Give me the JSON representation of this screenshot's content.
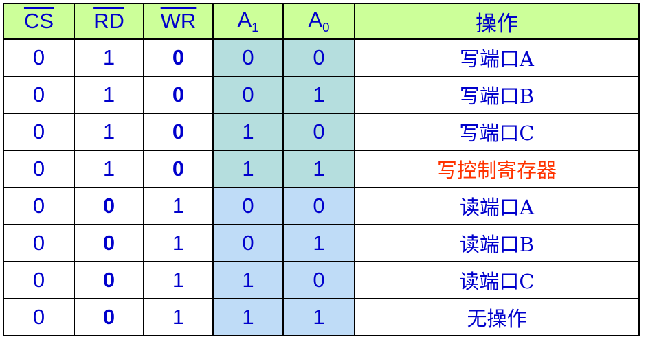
{
  "headers": {
    "cs": "CS",
    "rd": "RD",
    "wr": "WR",
    "a1_base": "A",
    "a1_sub": "1",
    "a0_base": "A",
    "a0_sub": "0",
    "op": "操作"
  },
  "colors": {
    "header_bg": "#ccff99",
    "text": "#0000cc",
    "highlight_text": "#ff3300",
    "write_address_bg": "#b5dede",
    "read_address_bg": "#bfdcf7"
  },
  "rows": [
    {
      "cs": "0",
      "rd": "1",
      "wr": "0",
      "a1": "1",
      "a0": "0",
      "op": ""
    },
    {
      "cs": "0",
      "rd": "1",
      "wr": "0",
      "a1": "0",
      "a0": "0",
      "op": "写端口A"
    },
    {
      "cs": "0",
      "rd": "1",
      "wr": "0",
      "a1": "0",
      "a0": "1",
      "op": "写端口B"
    },
    {
      "cs": "0",
      "rd": "1",
      "wr": "0",
      "a1": "1",
      "a0": "0",
      "op": "写端口C"
    },
    {
      "cs": "0",
      "rd": "1",
      "wr": "0",
      "a1": "1",
      "a0": "1",
      "op": "写控制寄存器"
    },
    {
      "cs": "0",
      "rd": "0",
      "wr": "1",
      "a1": "0",
      "a0": "0",
      "op": "读端口A"
    },
    {
      "cs": "0",
      "rd": "0",
      "wr": "1",
      "a1": "0",
      "a0": "1",
      "op": "读端口B"
    },
    {
      "cs": "0",
      "rd": "0",
      "wr": "1",
      "a1": "1",
      "a0": "0",
      "op": "读端口C"
    },
    {
      "cs": "0",
      "rd": "0",
      "wr": "1",
      "a1": "1",
      "a0": "1",
      "op": "无操作"
    }
  ]
}
